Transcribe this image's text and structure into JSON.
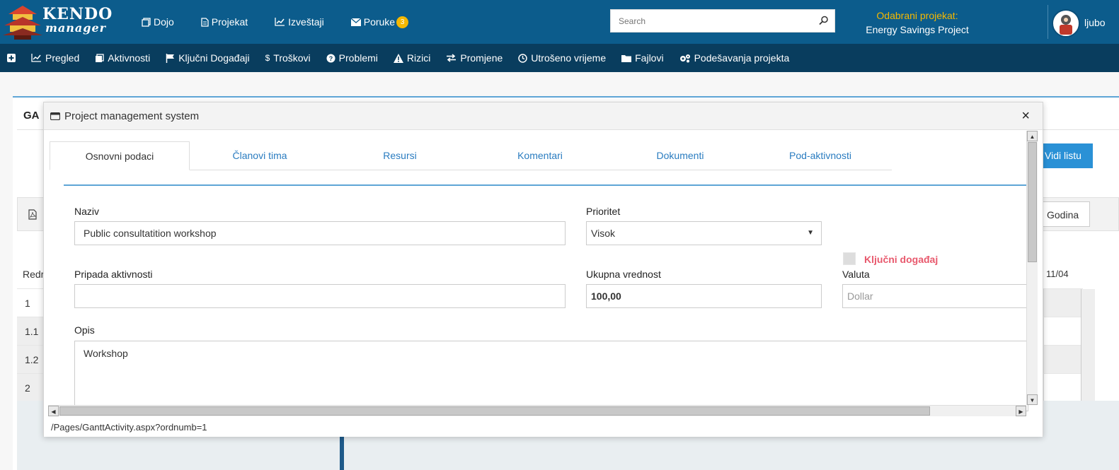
{
  "app": {
    "logo_line1": "KENDO",
    "logo_line2": "manager"
  },
  "topnav": [
    {
      "label": "Dojo",
      "icon": "copy-icon"
    },
    {
      "label": "Projekat",
      "icon": "document-icon"
    },
    {
      "label": "Izveštaji",
      "icon": "chart-line-icon"
    },
    {
      "label": "Poruke",
      "icon": "envelope-icon",
      "badge": "3"
    }
  ],
  "search": {
    "placeholder": "Search"
  },
  "project": {
    "label": "Odabrani projekat:",
    "name": "Energy Savings Project"
  },
  "user": {
    "name": "ljubo"
  },
  "menubar": [
    {
      "label": "Pregled",
      "icon": "chart-line-icon"
    },
    {
      "label": "Aktivnosti",
      "icon": "copy-icon"
    },
    {
      "label": "Ključni Događaji",
      "icon": "flag-icon"
    },
    {
      "label": "Troškovi",
      "icon": "dollar-icon"
    },
    {
      "label": "Problemi",
      "icon": "question-icon"
    },
    {
      "label": "Rizici",
      "icon": "warning-icon"
    },
    {
      "label": "Promjene",
      "icon": "exchange-icon"
    },
    {
      "label": "Utrošeno vrijeme",
      "icon": "clock-icon"
    },
    {
      "label": "Fajlovi",
      "icon": "folder-icon"
    },
    {
      "label": "Podešavanja projekta",
      "icon": "gears-icon"
    }
  ],
  "background": {
    "title": "GA",
    "view_list_button": "Vidi listu",
    "period_button": "Godina",
    "rownum_header": "Redr",
    "date_header": "11/04",
    "rows": [
      "1",
      "1.1",
      "1.2",
      "2"
    ]
  },
  "modal": {
    "title": "Project management system",
    "close": "×",
    "footer_url": "/Pages/GanttActivity.aspx?ordnumb=1",
    "tabs": [
      "Osnovni podaci",
      "Članovi tima",
      "Resursi",
      "Komentari",
      "Dokumenti",
      "Pod-aktivnosti"
    ],
    "active_tab": "Osnovni podaci",
    "fields": {
      "name_label": "Naziv",
      "name_value": "Public consultatition workshop",
      "priority_label": "Prioritet",
      "priority_value": "Visok",
      "milestone_label": "Ključni događaj",
      "parent_label": "Pripada aktivnosti",
      "parent_value": "",
      "total_label": "Ukupna vrednost",
      "total_value": "100,00",
      "currency_label": "Valuta",
      "currency_placeholder": "Dollar",
      "description_label": "Opis",
      "description_value": "Workshop"
    }
  },
  "colors": {
    "topbar": "#0c5c8c",
    "menubar": "#093d5e",
    "accent": "#2a91d6",
    "project_label": "#f5b800",
    "milestone_label": "#e8596d"
  }
}
